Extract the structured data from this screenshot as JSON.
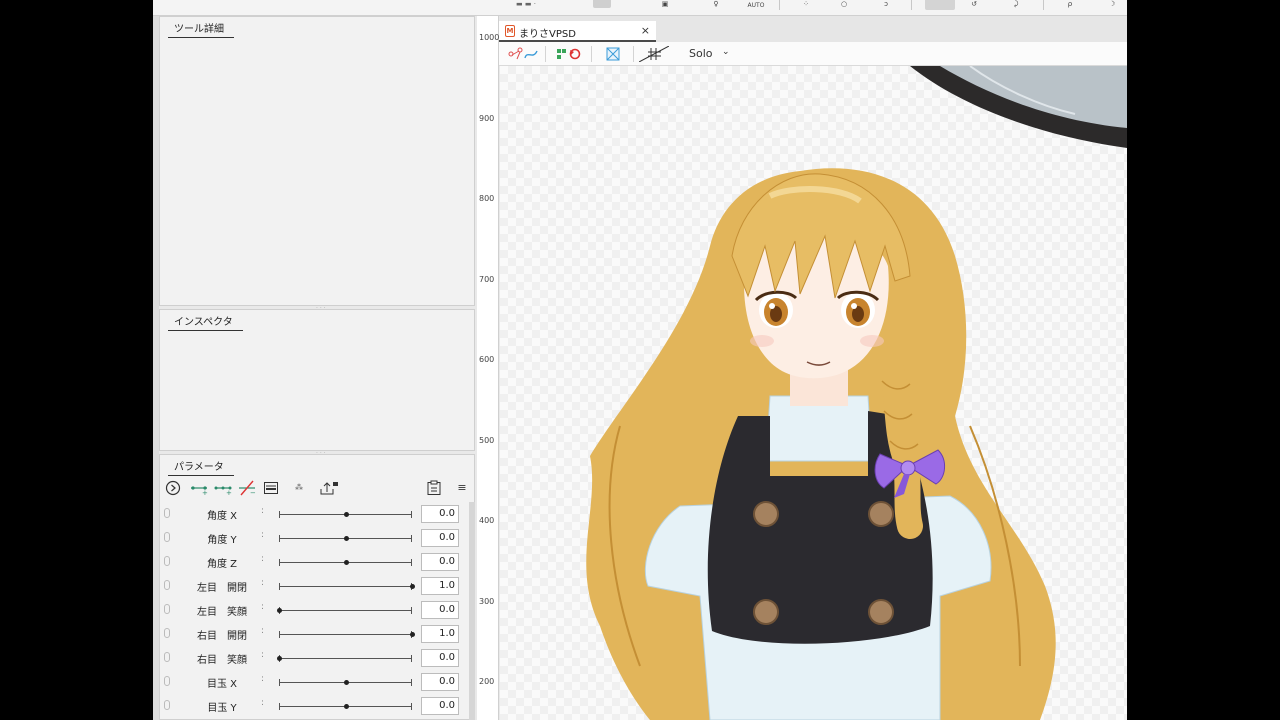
{
  "toolbar": {
    "auto_label": "AUTO"
  },
  "panels": {
    "tool_details": {
      "title": "ツール詳細"
    },
    "inspector": {
      "title": "インスペクタ"
    },
    "parameters": {
      "title": "パラメータ",
      "toolbar_icons": [
        "play-circle-icon",
        "add-keyform-icon",
        "add-3-keyforms-icon",
        "delete-keyform-icon",
        "parameter-panel-icon",
        "group-icon",
        "export-lock-icon",
        "clipboard-icon",
        "menu-icon"
      ],
      "rows": [
        {
          "label": "角度 X",
          "value": "0.0",
          "position": 0.5
        },
        {
          "label": "角度 Y",
          "value": "0.0",
          "position": 0.5
        },
        {
          "label": "角度 Z",
          "value": "0.0",
          "position": 0.5
        },
        {
          "label": "左目　開閉",
          "value": "1.0",
          "position": 1.0
        },
        {
          "label": "左目　笑顔",
          "value": "0.0",
          "position": 0.0
        },
        {
          "label": "右目　開閉",
          "value": "1.0",
          "position": 1.0
        },
        {
          "label": "右目　笑顔",
          "value": "0.0",
          "position": 0.0
        },
        {
          "label": "目玉 X",
          "value": "0.0",
          "position": 0.5
        },
        {
          "label": "目玉 Y",
          "value": "0.0",
          "position": 0.5
        }
      ]
    }
  },
  "ruler": {
    "labels": [
      "1000",
      "900",
      "800",
      "700",
      "600",
      "500",
      "400",
      "300",
      "200"
    ]
  },
  "document": {
    "tab_title": "まりさVPSD",
    "tab_close": "×",
    "solo_label": "Solo",
    "solo_chevron": "⌄"
  },
  "colors": {
    "hair": "#e2b55a",
    "vest": "#2b2a2f",
    "blouse": "#e6f2f7",
    "ribbon": "#9a6ae6",
    "hat": "#2c2a2a"
  }
}
